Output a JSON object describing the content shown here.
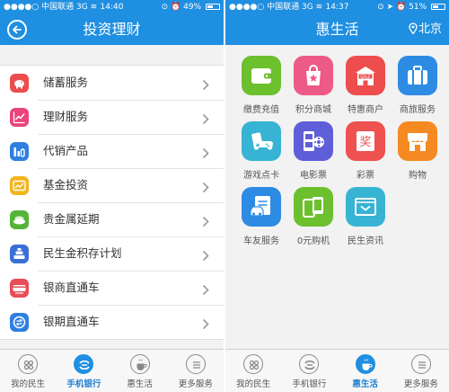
{
  "left": {
    "status": {
      "carrier": "中国联通",
      "network": "3G",
      "time": "14:40",
      "battery": "49%",
      "battery_level": 0.49
    },
    "nav": {
      "title": "投资理财"
    },
    "items": [
      {
        "label": "储蓄服务",
        "icon": "piggy-bank-icon",
        "color": "#ec4d4d"
      },
      {
        "label": "理财服务",
        "icon": "trend-chart-icon",
        "color": "#e9457c"
      },
      {
        "label": "代销产品",
        "icon": "bar-chart-icon",
        "color": "#2f7fe0"
      },
      {
        "label": "基金投资",
        "icon": "fund-icon",
        "color": "#f2b51c"
      },
      {
        "label": "贵金属延期",
        "icon": "gold-bars-icon",
        "color": "#55b336"
      },
      {
        "label": "民生金积存计划",
        "icon": "gold-stack-icon",
        "color": "#3b6fd8"
      },
      {
        "label": "银商直通车",
        "icon": "card-icon",
        "color": "#ea4c58"
      },
      {
        "label": "银期直通车",
        "icon": "exchange-icon",
        "color": "#2f7fe0"
      }
    ],
    "tabs": [
      {
        "label": "我的民生",
        "icon": "grid-icon",
        "active": false
      },
      {
        "label": "手机银行",
        "icon": "bank-logo-icon",
        "active": true
      },
      {
        "label": "惠生活",
        "icon": "cup-icon",
        "active": false
      },
      {
        "label": "更多服务",
        "icon": "menu-icon",
        "active": false
      }
    ]
  },
  "right": {
    "status": {
      "carrier": "中国联通",
      "network": "3G",
      "time": "14:37",
      "battery": "51%",
      "battery_level": 0.51
    },
    "nav": {
      "title": "惠生活",
      "city": "北京"
    },
    "tiles": [
      {
        "label": "缴费充值",
        "icon": "wallet-icon",
        "color": "#6cc02e"
      },
      {
        "label": "积分商城",
        "icon": "shopping-bag-icon",
        "color": "#ee5a87"
      },
      {
        "label": "特惠商户",
        "icon": "sale-store-icon",
        "color": "#ee4d4d"
      },
      {
        "label": "商旅服务",
        "icon": "suitcase-icon",
        "color": "#2e8be4"
      },
      {
        "label": "游戏点卡",
        "icon": "gamepad-icon",
        "color": "#37b3d3"
      },
      {
        "label": "电影票",
        "icon": "film-icon",
        "color": "#5f5ed9"
      },
      {
        "label": "彩票",
        "icon": "lottery-icon",
        "color": "#ef5050"
      },
      {
        "label": "购物",
        "icon": "store-icon",
        "color": "#f58a22"
      },
      {
        "label": "车友服务",
        "icon": "car-clipboard-icon",
        "color": "#2e8be4"
      },
      {
        "label": "0元购机",
        "icon": "phones-icon",
        "color": "#6cc02e"
      },
      {
        "label": "民生资讯",
        "icon": "news-icon",
        "color": "#37b3d3"
      }
    ],
    "tabs": [
      {
        "label": "我的民生",
        "icon": "grid-icon",
        "active": false
      },
      {
        "label": "手机银行",
        "icon": "bank-logo-icon",
        "active": false
      },
      {
        "label": "惠生活",
        "icon": "cup-icon",
        "active": true
      },
      {
        "label": "更多服务",
        "icon": "menu-icon",
        "active": false
      }
    ]
  }
}
